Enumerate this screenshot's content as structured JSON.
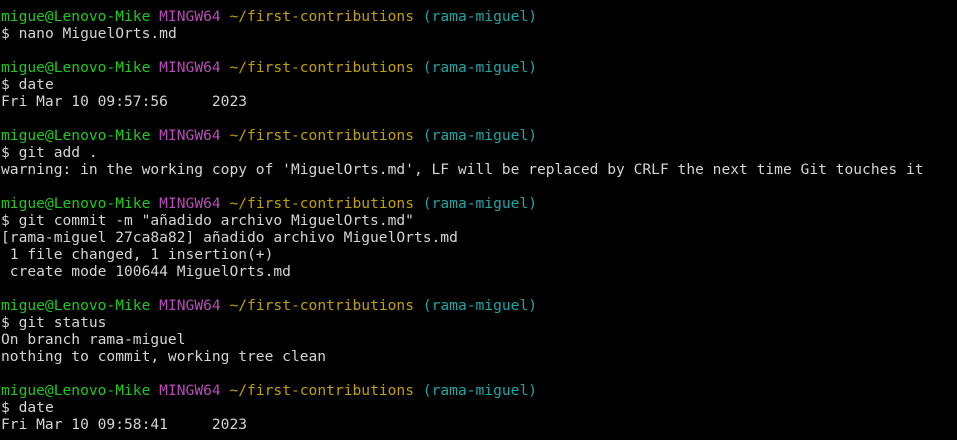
{
  "colors": {
    "background": "#000000",
    "text": "#cccccc",
    "user_host": "#1ec91e",
    "mingw": "#b84cb8",
    "path": "#c2a000",
    "branch": "#1ea5a5"
  },
  "prompt": {
    "user_host": "migue@Lenovo-Mike",
    "env": "MINGW64",
    "path": "~/first-contributions",
    "branch": "(rama-miguel)",
    "symbol": "$"
  },
  "blocks": [
    {
      "command": "nano MiguelOrts.md",
      "output": []
    },
    {
      "command": "date",
      "output": [
        "Fri Mar 10 09:57:56     2023"
      ]
    },
    {
      "command": "git add .",
      "output": [
        "warning: in the working copy of 'MiguelOrts.md', LF will be replaced by CRLF the next time Git touches it"
      ]
    },
    {
      "command": "git commit -m \"añadido archivo MiguelOrts.md\"",
      "output": [
        "[rama-miguel 27ca8a82] añadido archivo MiguelOrts.md",
        " 1 file changed, 1 insertion(+)",
        " create mode 100644 MiguelOrts.md"
      ]
    },
    {
      "command": "git status",
      "output": [
        "On branch rama-miguel",
        "nothing to commit, working tree clean"
      ]
    },
    {
      "command": "date",
      "output": [
        "Fri Mar 10 09:58:41     2023"
      ]
    }
  ]
}
